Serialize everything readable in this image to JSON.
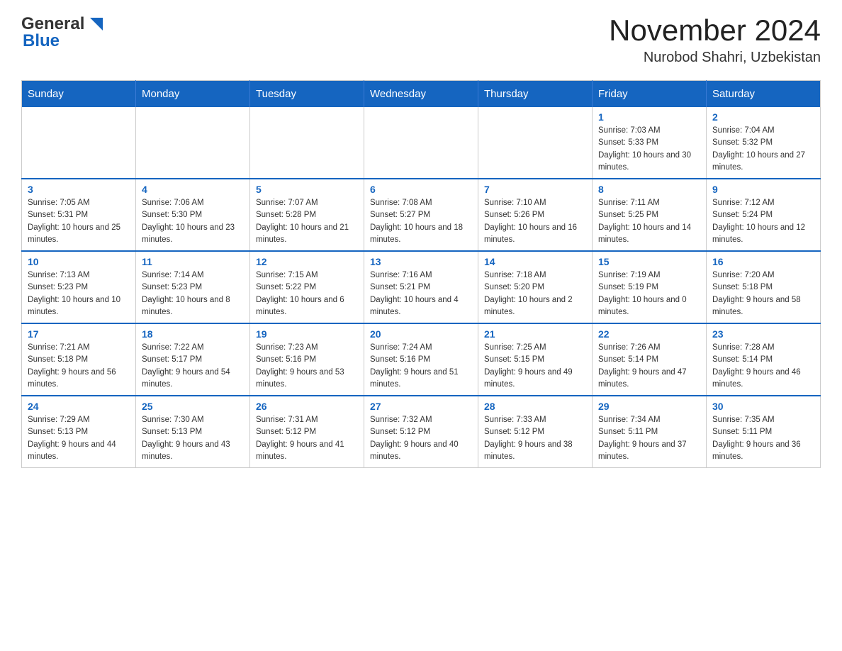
{
  "header": {
    "logo_general": "General",
    "logo_blue": "Blue",
    "month_title": "November 2024",
    "location": "Nurobod Shahri, Uzbekistan"
  },
  "weekdays": [
    "Sunday",
    "Monday",
    "Tuesday",
    "Wednesday",
    "Thursday",
    "Friday",
    "Saturday"
  ],
  "weeks": [
    [
      {
        "day": "",
        "info": ""
      },
      {
        "day": "",
        "info": ""
      },
      {
        "day": "",
        "info": ""
      },
      {
        "day": "",
        "info": ""
      },
      {
        "day": "",
        "info": ""
      },
      {
        "day": "1",
        "info": "Sunrise: 7:03 AM\nSunset: 5:33 PM\nDaylight: 10 hours and 30 minutes."
      },
      {
        "day": "2",
        "info": "Sunrise: 7:04 AM\nSunset: 5:32 PM\nDaylight: 10 hours and 27 minutes."
      }
    ],
    [
      {
        "day": "3",
        "info": "Sunrise: 7:05 AM\nSunset: 5:31 PM\nDaylight: 10 hours and 25 minutes."
      },
      {
        "day": "4",
        "info": "Sunrise: 7:06 AM\nSunset: 5:30 PM\nDaylight: 10 hours and 23 minutes."
      },
      {
        "day": "5",
        "info": "Sunrise: 7:07 AM\nSunset: 5:28 PM\nDaylight: 10 hours and 21 minutes."
      },
      {
        "day": "6",
        "info": "Sunrise: 7:08 AM\nSunset: 5:27 PM\nDaylight: 10 hours and 18 minutes."
      },
      {
        "day": "7",
        "info": "Sunrise: 7:10 AM\nSunset: 5:26 PM\nDaylight: 10 hours and 16 minutes."
      },
      {
        "day": "8",
        "info": "Sunrise: 7:11 AM\nSunset: 5:25 PM\nDaylight: 10 hours and 14 minutes."
      },
      {
        "day": "9",
        "info": "Sunrise: 7:12 AM\nSunset: 5:24 PM\nDaylight: 10 hours and 12 minutes."
      }
    ],
    [
      {
        "day": "10",
        "info": "Sunrise: 7:13 AM\nSunset: 5:23 PM\nDaylight: 10 hours and 10 minutes."
      },
      {
        "day": "11",
        "info": "Sunrise: 7:14 AM\nSunset: 5:23 PM\nDaylight: 10 hours and 8 minutes."
      },
      {
        "day": "12",
        "info": "Sunrise: 7:15 AM\nSunset: 5:22 PM\nDaylight: 10 hours and 6 minutes."
      },
      {
        "day": "13",
        "info": "Sunrise: 7:16 AM\nSunset: 5:21 PM\nDaylight: 10 hours and 4 minutes."
      },
      {
        "day": "14",
        "info": "Sunrise: 7:18 AM\nSunset: 5:20 PM\nDaylight: 10 hours and 2 minutes."
      },
      {
        "day": "15",
        "info": "Sunrise: 7:19 AM\nSunset: 5:19 PM\nDaylight: 10 hours and 0 minutes."
      },
      {
        "day": "16",
        "info": "Sunrise: 7:20 AM\nSunset: 5:18 PM\nDaylight: 9 hours and 58 minutes."
      }
    ],
    [
      {
        "day": "17",
        "info": "Sunrise: 7:21 AM\nSunset: 5:18 PM\nDaylight: 9 hours and 56 minutes."
      },
      {
        "day": "18",
        "info": "Sunrise: 7:22 AM\nSunset: 5:17 PM\nDaylight: 9 hours and 54 minutes."
      },
      {
        "day": "19",
        "info": "Sunrise: 7:23 AM\nSunset: 5:16 PM\nDaylight: 9 hours and 53 minutes."
      },
      {
        "day": "20",
        "info": "Sunrise: 7:24 AM\nSunset: 5:16 PM\nDaylight: 9 hours and 51 minutes."
      },
      {
        "day": "21",
        "info": "Sunrise: 7:25 AM\nSunset: 5:15 PM\nDaylight: 9 hours and 49 minutes."
      },
      {
        "day": "22",
        "info": "Sunrise: 7:26 AM\nSunset: 5:14 PM\nDaylight: 9 hours and 47 minutes."
      },
      {
        "day": "23",
        "info": "Sunrise: 7:28 AM\nSunset: 5:14 PM\nDaylight: 9 hours and 46 minutes."
      }
    ],
    [
      {
        "day": "24",
        "info": "Sunrise: 7:29 AM\nSunset: 5:13 PM\nDaylight: 9 hours and 44 minutes."
      },
      {
        "day": "25",
        "info": "Sunrise: 7:30 AM\nSunset: 5:13 PM\nDaylight: 9 hours and 43 minutes."
      },
      {
        "day": "26",
        "info": "Sunrise: 7:31 AM\nSunset: 5:12 PM\nDaylight: 9 hours and 41 minutes."
      },
      {
        "day": "27",
        "info": "Sunrise: 7:32 AM\nSunset: 5:12 PM\nDaylight: 9 hours and 40 minutes."
      },
      {
        "day": "28",
        "info": "Sunrise: 7:33 AM\nSunset: 5:12 PM\nDaylight: 9 hours and 38 minutes."
      },
      {
        "day": "29",
        "info": "Sunrise: 7:34 AM\nSunset: 5:11 PM\nDaylight: 9 hours and 37 minutes."
      },
      {
        "day": "30",
        "info": "Sunrise: 7:35 AM\nSunset: 5:11 PM\nDaylight: 9 hours and 36 minutes."
      }
    ]
  ]
}
